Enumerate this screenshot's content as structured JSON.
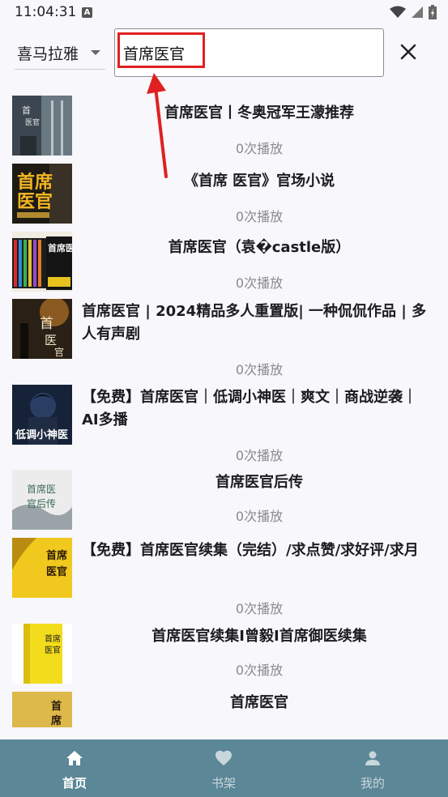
{
  "status_bar": {
    "time": "11:04:31",
    "indicator": "A"
  },
  "search": {
    "source": "喜马拉雅",
    "query": "首席医官"
  },
  "results": [
    {
      "title": "首席医官丨冬奥冠军王濛推荐",
      "plays": "0次播放"
    },
    {
      "title": "《首席 医官》官场小说",
      "plays": "0次播放"
    },
    {
      "title": "首席医官（袁�castle版）",
      "plays": "0次播放"
    },
    {
      "title": "首席医官 | 2024精品多人重置版| 一种侃侃作品 | 多人有声剧",
      "plays": "0次播放"
    },
    {
      "title": "【免费】首席医官｜低调小神医｜爽文｜商战逆袭｜AI多播",
      "plays": "0次播放"
    },
    {
      "title": "首席医官后传",
      "plays": "0次播放"
    },
    {
      "title": "【免费】首席医官续集（完结）/求点赞/求好评/求月",
      "plays": "0次播放"
    },
    {
      "title": "首席医官续集I曾毅I首席御医续集",
      "plays": "0次播放"
    },
    {
      "title": "首席医官",
      "plays": ""
    }
  ],
  "nav": {
    "home": "首页",
    "shelf": "书架",
    "mine": "我的"
  },
  "colors": {
    "nav_bg": "#5b8797",
    "highlight": "#e02020"
  }
}
